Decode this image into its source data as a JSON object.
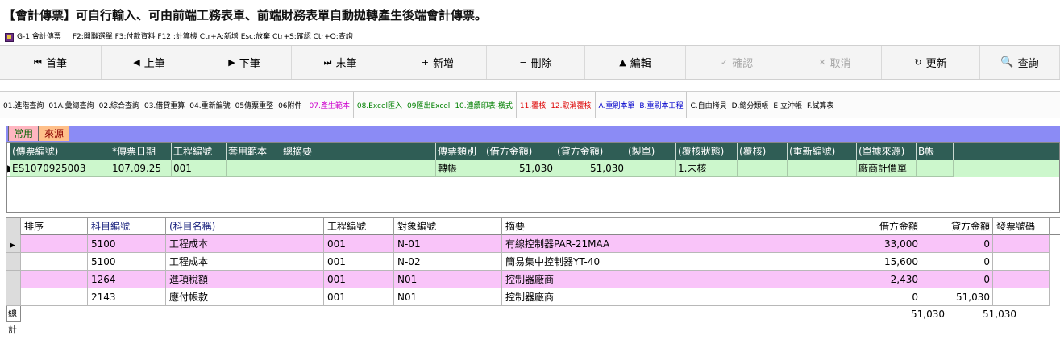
{
  "heading": "【會計傳票】可自行輸入、可由前端工務表單、前端財務表單自動拋轉產生後端會計傳票。",
  "window": {
    "title": "G-1 會計傳票",
    "shortcuts": "F2:開聯選單  F3:付款資料  F12 :計算機  Ctr+A:新增  Esc:放棄  Ctr+S:確認  Ctr+Q:查詢"
  },
  "toolbar": [
    {
      "label": "首筆",
      "icon": "⏮",
      "icon_name": "first-record-icon",
      "enabled": true
    },
    {
      "label": "上筆",
      "icon": "◀",
      "icon_name": "previous-record-icon",
      "enabled": true
    },
    {
      "label": "下筆",
      "icon": "▶",
      "icon_name": "next-record-icon",
      "enabled": true
    },
    {
      "label": "末筆",
      "icon": "⏭",
      "icon_name": "last-record-icon",
      "enabled": true
    },
    {
      "label": "新增",
      "icon": "+",
      "icon_name": "add-icon",
      "enabled": true
    },
    {
      "label": "刪除",
      "icon": "−",
      "icon_name": "delete-icon",
      "enabled": true
    },
    {
      "label": "編輯",
      "icon": "▲",
      "icon_name": "edit-icon",
      "enabled": true
    },
    {
      "label": "確認",
      "icon": "✓",
      "icon_name": "confirm-icon",
      "enabled": false
    },
    {
      "label": "取消",
      "icon": "✕",
      "icon_name": "cancel-icon",
      "enabled": false
    },
    {
      "label": "更新",
      "icon": "↻",
      "icon_name": "refresh-icon",
      "enabled": true
    },
    {
      "label": "查詢",
      "icon": "🔍",
      "icon_name": "search-icon",
      "enabled": true
    }
  ],
  "function_groups": [
    {
      "color": "#000000",
      "items": [
        "01.進階查詢",
        "01A.彙總查詢",
        "02.綜合查詢",
        "03.借貸重算",
        "04.重新編號",
        "05傳票重整",
        "06附件"
      ]
    },
    {
      "color": "#cc00cc",
      "items": [
        "07.產生範本"
      ]
    },
    {
      "color": "#008000",
      "items": [
        "08.Excel匯入",
        "09匯出Excel",
        "10.連續印表-橫式"
      ]
    },
    {
      "color": "#dd0000",
      "items": [
        "11.覆核",
        "12.取消覆核"
      ]
    },
    {
      "color": "#0000cc",
      "items": [
        "A.重刷本單",
        "B.重刷本工程"
      ]
    },
    {
      "color": "#000000",
      "items": [
        "C.自由拷貝",
        "D.總分類帳",
        "E.立沖帳",
        "F.試算表"
      ]
    }
  ],
  "tabs": {
    "common": "常用",
    "source": "來源"
  },
  "voucher_grid": {
    "columns": [
      "(傳票編號)",
      "*傳票日期",
      "工程編號",
      "套用範本",
      "總摘要",
      "傳票類別",
      "(借方金額)",
      "(貸方金額)",
      "(製單)",
      "(覆核狀態)",
      "(覆核)",
      "(重新編號)",
      "(單據來源)",
      "B帳"
    ],
    "rows": [
      [
        "ES1070925003",
        "107.09.25",
        "001",
        "",
        "",
        "轉帳",
        "51,030",
        "51,030",
        "",
        "1.未核",
        "",
        "",
        "廠商計價單",
        ""
      ]
    ]
  },
  "detail_grid": {
    "columns": [
      "",
      "排序",
      "科目編號",
      "(科目名稱)",
      "工程編號",
      "對象編號",
      "摘要",
      "借方金額",
      "貸方金額",
      "發票號碼"
    ],
    "rows": [
      {
        "style": "pink",
        "selected": true,
        "cells": [
          "",
          "",
          "5100",
          "工程成本",
          "001",
          "N-01",
          "有線控制器PAR-21MAA",
          "33,000",
          "0",
          ""
        ]
      },
      {
        "style": "white",
        "selected": false,
        "cells": [
          "",
          "",
          "5100",
          "工程成本",
          "001",
          "N-02",
          "簡易集中控制器YT-40",
          "15,600",
          "0",
          ""
        ]
      },
      {
        "style": "pink",
        "selected": false,
        "cells": [
          "",
          "",
          "1264",
          "進項稅額",
          "001",
          "N01",
          "控制器廠商",
          "2,430",
          "0",
          ""
        ]
      },
      {
        "style": "white",
        "selected": false,
        "cells": [
          "",
          "",
          "2143",
          "應付帳款",
          "001",
          "N01",
          "控制器廠商",
          "0",
          "51,030",
          ""
        ]
      }
    ],
    "total_label": "總計",
    "total_debit": "51,030",
    "total_credit": "51,030"
  }
}
